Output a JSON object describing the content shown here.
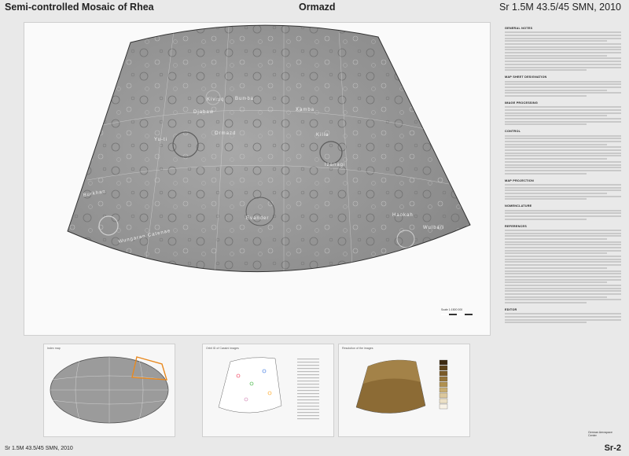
{
  "header": {
    "title": "Semi-controlled Mosaic of Rhea",
    "quadrangle": "Ormazd",
    "sheet_code": "Sr 1.5M 43.5/45 SMN, 2010"
  },
  "footer": {
    "code": "Sr 1.5M 43.5/45 SMN, 2010",
    "sheet": "Sr-2"
  },
  "map": {
    "features": [
      {
        "name": "Bumba"
      },
      {
        "name": "Ormazd"
      },
      {
        "name": "Kiviuq"
      },
      {
        "name": "Kilia"
      },
      {
        "name": "Izanagi"
      },
      {
        "name": "Evander"
      },
      {
        "name": "Haokah"
      },
      {
        "name": "Wungaran Catenae"
      },
      {
        "name": "Burkhan"
      },
      {
        "name": "Wulbari"
      },
      {
        "name": "Xamba"
      },
      {
        "name": "Yu-ti"
      },
      {
        "name": "Djabaw"
      }
    ],
    "scale_label": "Scale 1:1500 000"
  },
  "sidebar": {
    "sections": [
      {
        "heading": "GENERAL NOTES",
        "lines": 14
      },
      {
        "heading": "MAP SHEET DESIGNATION",
        "lines": 6
      },
      {
        "heading": "IMAGE PROCESSING",
        "lines": 7
      },
      {
        "heading": "CONTROL",
        "lines": 14
      },
      {
        "heading": "MAP PROJECTION",
        "lines": 6
      },
      {
        "heading": "NOMENCLATURE",
        "lines": 4
      },
      {
        "heading": "REFERENCES",
        "lines": 26
      },
      {
        "heading": "EDITOR",
        "lines": 4
      }
    ],
    "org": "German Aerospace Center"
  },
  "insets": {
    "index_map": "Index map",
    "orbits": "Orbit ID of Cassini images",
    "resolution": "Resolution of the images"
  }
}
